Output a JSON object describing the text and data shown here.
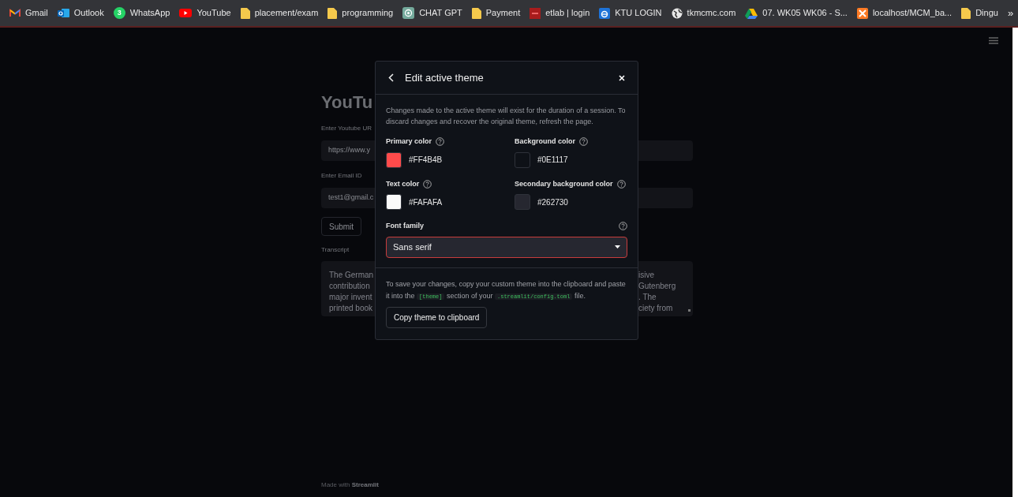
{
  "bookmarks": [
    {
      "label": "Gmail",
      "kind": "gmail"
    },
    {
      "label": "Outlook",
      "kind": "outlook"
    },
    {
      "label": "WhatsApp",
      "kind": "whatsapp",
      "badge": "3"
    },
    {
      "label": "YouTube",
      "kind": "youtube"
    },
    {
      "label": "placement/exam",
      "kind": "folder"
    },
    {
      "label": "programming",
      "kind": "folder"
    },
    {
      "label": "CHAT GPT",
      "kind": "chatgpt"
    },
    {
      "label": "Payment",
      "kind": "folder"
    },
    {
      "label": "etlab | login",
      "kind": "etlab"
    },
    {
      "label": "KTU LOGIN",
      "kind": "ktu"
    },
    {
      "label": "tkmcmc.com",
      "kind": "globe"
    },
    {
      "label": "07. WK05 WK06 - S...",
      "kind": "drive"
    },
    {
      "label": "localhost/MCM_ba...",
      "kind": "xampp"
    },
    {
      "label": "Dingu",
      "kind": "folder"
    }
  ],
  "bookmarks_overflow": "»",
  "app": {
    "title": "YouTu",
    "fields": [
      {
        "label": "Enter Youtube UR",
        "value": "https://www.y"
      },
      {
        "label": "Enter Email ID",
        "value": "test1@gmail.c"
      }
    ],
    "submit": "Submit",
    "transcript_label": "Transcript",
    "transcript_lines": [
      {
        "left": "The German",
        "right": "isive"
      },
      {
        "left": "contribution",
        "right": "Gutenberg"
      },
      {
        "left": "major invent",
        "right": ". The"
      },
      {
        "left": "printed book",
        "right": "ciety from"
      }
    ],
    "footer": {
      "prefix": "Made with",
      "brand": "Streamlit"
    }
  },
  "dialog": {
    "title": "Edit active theme",
    "intro": "Changes made to the active theme will exist for the duration of a session. To discard changes and recover the original theme, refresh the page.",
    "colors": [
      {
        "label": "Primary color",
        "value": "#FF4B4B",
        "color": "#ff4b4b"
      },
      {
        "label": "Background color",
        "value": "#0E1117",
        "color": "#0e1117"
      },
      {
        "label": "Text color",
        "value": "#FAFAFA",
        "color": "#fafafa"
      },
      {
        "label": "Secondary background color",
        "value": "#262730",
        "color": "#262730"
      }
    ],
    "font_family": {
      "label": "Font family",
      "value": "Sans serif",
      "focused": true
    },
    "save_note": [
      "To save your changes, copy your custom theme into the clipboard and paste it into the ",
      {
        "code": "[theme]"
      },
      " section of your ",
      {
        "code": ".streamlit/config.toml"
      },
      " file."
    ],
    "copy_button": "Copy theme to clipboard"
  }
}
